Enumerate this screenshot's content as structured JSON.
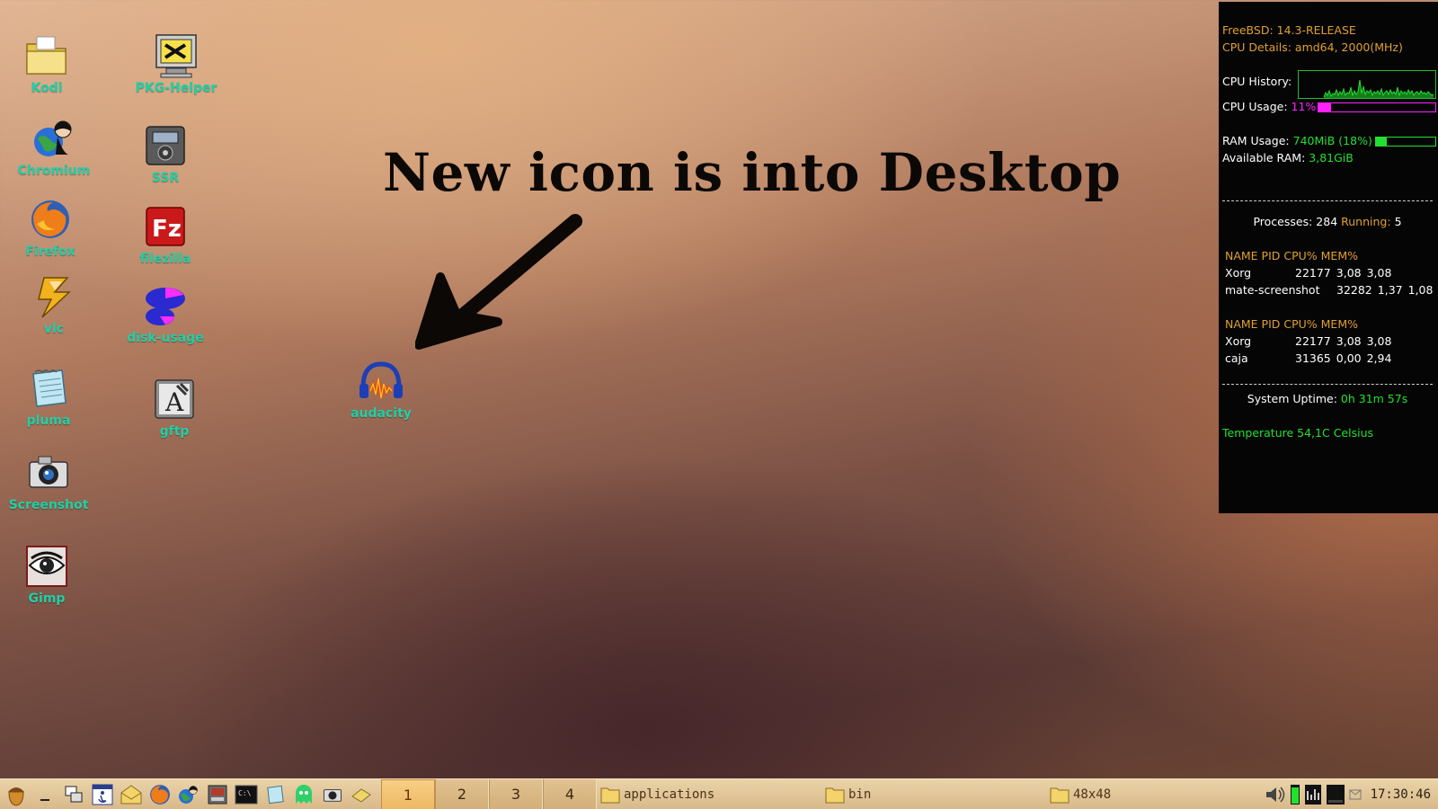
{
  "desktop": {
    "annotation": "New icon is into Desktop",
    "icons": {
      "kodi": "Kodi",
      "chromium": "Chromium",
      "firefox": "Firefox",
      "vlc": "vlc",
      "pluma": "pluma",
      "screenshot": "Screenshot",
      "gimp": "Gimp",
      "pkg_helper": "PKG-Helper",
      "ssr": "SSR",
      "filezilla": "filezilla",
      "disk_usage": "disk-usage",
      "gftp": "gftp",
      "audacity": "audacity"
    }
  },
  "conky": {
    "os": "FreeBSD: 14.3-RELEASE",
    "cpu_details": "CPU Details: amd64, 2000(MHz)",
    "cpu_history_label": "CPU History:",
    "cpu_usage_label": "CPU Usage:",
    "cpu_usage_value": "11%",
    "cpu_usage_fraction": 0.11,
    "ram_usage_label": "RAM Usage:",
    "ram_usage_value": "740MiB (18%)",
    "ram_usage_fraction": 0.18,
    "available_ram_label": "Available RAM:",
    "available_ram_value": "3,81GiB",
    "processes_label": "Processes:",
    "processes_value": "284",
    "running_label": "Running:",
    "running_value": "5",
    "table_header": "NAME PID CPU% MEM%",
    "cpu_table": [
      {
        "name": "Xorg",
        "pid": "22177",
        "cpu": "3,08",
        "mem": "3,08"
      },
      {
        "name": "mate-screenshot",
        "pid": "32282",
        "cpu": "1,37",
        "mem": "1,08"
      }
    ],
    "mem_table": [
      {
        "name": "Xorg",
        "pid": "22177",
        "cpu": "3,08",
        "mem": "3,08"
      },
      {
        "name": "caja",
        "pid": "31365",
        "cpu": "0,00",
        "mem": "2,94"
      }
    ],
    "uptime_label": "System Uptime:",
    "uptime_value": "0h 31m 57s",
    "temperature": "Temperature 54,1C Celsius",
    "colors": {
      "orange": "#e0a030",
      "green": "#22e030",
      "magenta": "#ff20ff"
    }
  },
  "taskbar": {
    "workspaces": [
      "1",
      "2",
      "3",
      "4"
    ],
    "active_workspace": "1",
    "tasks": [
      "applications",
      "bin",
      "48x48"
    ],
    "clock": "17:30:46",
    "launchers": [
      "acorn-icon",
      "minimize-icon",
      "window-list-icon",
      "accessibility-icon",
      "mail-icon",
      "firefox-icon",
      "chromium-icon",
      "pkg-tool-icon",
      "terminal-icon",
      "pluma-icon",
      "ghost-icon",
      "camera-icon",
      "eraser-icon"
    ]
  }
}
